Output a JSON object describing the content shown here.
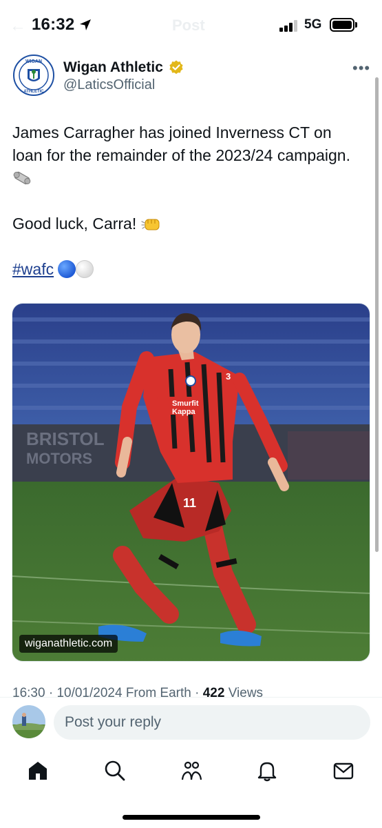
{
  "status_bar": {
    "time": "16:32",
    "network": "5G",
    "ghost_title": "Post"
  },
  "author": {
    "name": "Wigan Athletic",
    "handle": "@LaticsOfficial",
    "verified": true,
    "avatar": "wigan-athletic-crest"
  },
  "tweet": {
    "line1": "James Carragher has joined Inverness CT on loan for the remainder of the 2023/24 campaign.",
    "line2": "Good luck, Carra!",
    "hashtag": "#wafc"
  },
  "media": {
    "watermark": "wiganathletic.com",
    "sponsor_line1": "Smurfit",
    "sponsor_line2": "Kappa",
    "board_text": "BRISTOL",
    "board_text2": "MOTORS",
    "shirt_number": "11",
    "sleeve_number": "3"
  },
  "meta": {
    "time": "16:30",
    "date": "10/01/2024",
    "source": "From Earth",
    "views_count": "422",
    "views_label": "Views"
  },
  "reply": {
    "placeholder": "Post your reply"
  },
  "nav": {
    "items": [
      {
        "name": "home",
        "icon": "home-icon"
      },
      {
        "name": "search",
        "icon": "search-icon"
      },
      {
        "name": "communities",
        "icon": "communities-icon"
      },
      {
        "name": "notifications",
        "icon": "bell-icon"
      },
      {
        "name": "messages",
        "icon": "mail-icon"
      }
    ]
  },
  "colors": {
    "text": "#0f1419",
    "secondary": "#536471",
    "hashtag": "#1d3f8f",
    "verified": "#e2b719",
    "reply_bg": "#eff3f4"
  }
}
